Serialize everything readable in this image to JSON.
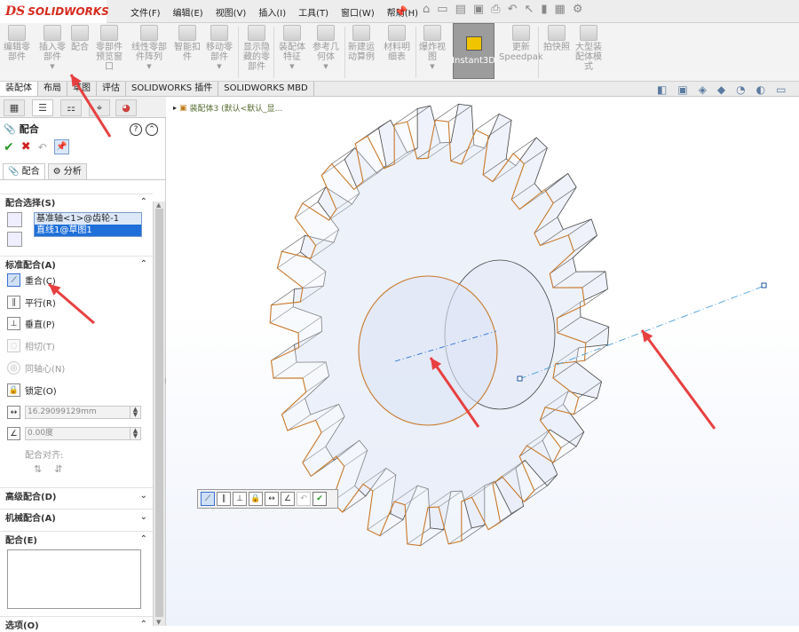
{
  "app": {
    "logo_ds": "DS",
    "logo_name": "SOLIDWORKS"
  },
  "menu": [
    "文件(F)",
    "编辑(E)",
    "视图(V)",
    "插入(I)",
    "工具(T)",
    "窗口(W)",
    "帮助(H)"
  ],
  "ribbon": [
    {
      "label": "编辑零\n部件"
    },
    {
      "label": "插入零\n部件"
    },
    {
      "label": "配合"
    },
    {
      "label": "零部件\n预览窗\n口"
    },
    {
      "label": "线性零部\n件阵列"
    },
    {
      "label": "智能扣\n件"
    },
    {
      "label": "移动零\n部件"
    },
    {
      "label": "显示隐\n藏的零\n部件"
    },
    {
      "label": "装配体\n特征"
    },
    {
      "label": "参考几\n何体"
    },
    {
      "label": "新建运\n动算例"
    },
    {
      "label": "材料明\n细表"
    },
    {
      "label": "爆炸视\n图"
    },
    {
      "label": "更新\nSpeedpak"
    },
    {
      "label": "拍快照"
    },
    {
      "label": "大型装\n配体模\n式"
    }
  ],
  "instant3d": "Instant3D",
  "tabs": [
    "装配体",
    "布局",
    "草图",
    "评估",
    "SOLIDWORKS 插件",
    "SOLIDWORKS MBD"
  ],
  "tree_path": "装配体3 (默认<默认_显...",
  "property_manager": {
    "title": "配合",
    "help": "?",
    "subtabs": [
      "配合",
      "分析"
    ],
    "selection_section": "配合选择(S)",
    "selections": [
      "基准轴<1>@齿轮-1",
      "直线1@草图1"
    ],
    "standard_section": "标准配合(A)",
    "mates": [
      {
        "label": "重合(C)",
        "state": "active"
      },
      {
        "label": "平行(R)",
        "state": "enabled"
      },
      {
        "label": "垂直(P)",
        "state": "enabled"
      },
      {
        "label": "相切(T)",
        "state": "disabled"
      },
      {
        "label": "同轴心(N)",
        "state": "disabled"
      },
      {
        "label": "锁定(O)",
        "state": "enabled"
      }
    ],
    "distance_value": "16.29099129mm",
    "angle_value": "0.00度",
    "alignment_label": "配合对齐:",
    "advanced_section": "高级配合(D)",
    "mechanical_section": "机械配合(A)",
    "comments_section": "配合(E)",
    "options_section": "选项(O)"
  },
  "icons": {
    "ok": "check-icon",
    "cancel": "close-icon",
    "pin": "pushpin-icon",
    "gear": "gear-icon"
  },
  "colors": {
    "brand_red": "#d52b1e",
    "selection_blue": "#1e6fd9",
    "gear_edge_orange": "#c8782a",
    "axis_blue": "#2a6fd0",
    "arrow_red": "#e84040"
  }
}
